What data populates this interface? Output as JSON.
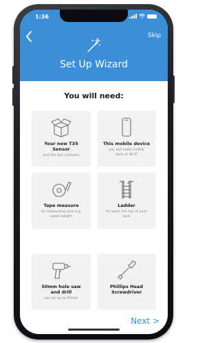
{
  "status_bar": {
    "time": "1:36"
  },
  "header": {
    "back_icon": "chevron-left-icon",
    "skip_label": "Skip",
    "wizard_icon": "magic-wand-icon",
    "title": "Set Up Wizard"
  },
  "colors": {
    "header_blue": "#3c8ed9",
    "card_bg": "#f2f2f2",
    "link_blue": "#3c8ed9"
  },
  "main": {
    "subtitle": "You will need:",
    "items": [
      {
        "icon": "box-icon",
        "title": "Your new T35\nSensor",
        "subtitle": "and the box contents"
      },
      {
        "icon": "smartphone-icon",
        "title": "This mobile device",
        "subtitle": "you will need mobile\ndata or Wi-Fi"
      },
      {
        "icon": "tape-measure-icon",
        "title": "Tape measure",
        "subtitle": "for measuring tank e.g.\nwater height"
      },
      {
        "icon": "ladder-icon",
        "title": "Ladder",
        "subtitle": "to reach the top of your\ntank"
      },
      {
        "icon": "drill-icon",
        "title": "50mm hole saw\nand drill",
        "subtitle": "can be up to 60mm"
      },
      {
        "icon": "screwdriver-icon",
        "title": "Phillips Head\nScrewdriver",
        "subtitle": ""
      }
    ]
  },
  "footer": {
    "next_label": "Next >"
  }
}
